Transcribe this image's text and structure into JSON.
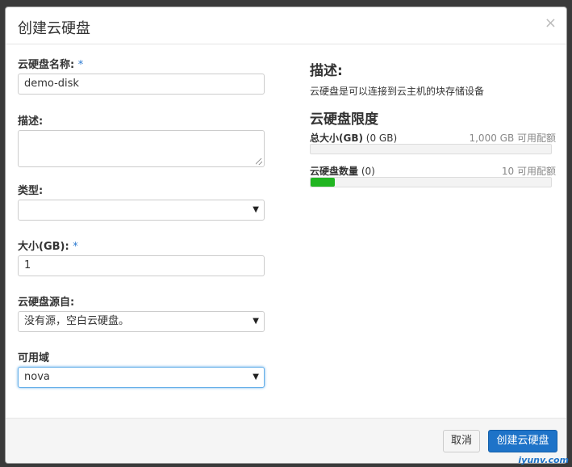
{
  "dialog": {
    "title": "创建云硬盘",
    "close_icon": "×"
  },
  "form": {
    "name_label": "云硬盘名称:",
    "name_required": "*",
    "name_value": "demo-disk",
    "desc_label": "描述:",
    "desc_value": "",
    "type_label": "类型:",
    "type_value": "",
    "size_label": "大小(GB):",
    "size_required": "*",
    "size_value": "1",
    "source_label": "云硬盘源自:",
    "source_value": "没有源，空白云硬盘。",
    "zone_label": "可用域",
    "zone_value": "nova",
    "dropdown_arrow": "▼"
  },
  "info": {
    "desc_title": "描述:",
    "desc_text": "云硬盘是可以连接到云主机的块存储设备",
    "limits_title": "云硬盘限度",
    "quotas": [
      {
        "label": "总大小(GB)",
        "used": "(0 GB)",
        "available": "1,000 GB 可用配额",
        "used_fraction": 0.0
      },
      {
        "label": "云硬盘数量",
        "used": "(0)",
        "available": "10 可用配额",
        "used_fraction": 0.1
      }
    ]
  },
  "footer": {
    "cancel_label": "取消",
    "submit_label": "创建云硬盘"
  },
  "watermark": "iyunv.com",
  "colors": {
    "primary": "#1e73c8",
    "quota_fill": "#21b521",
    "required": "#2c7bd1"
  }
}
